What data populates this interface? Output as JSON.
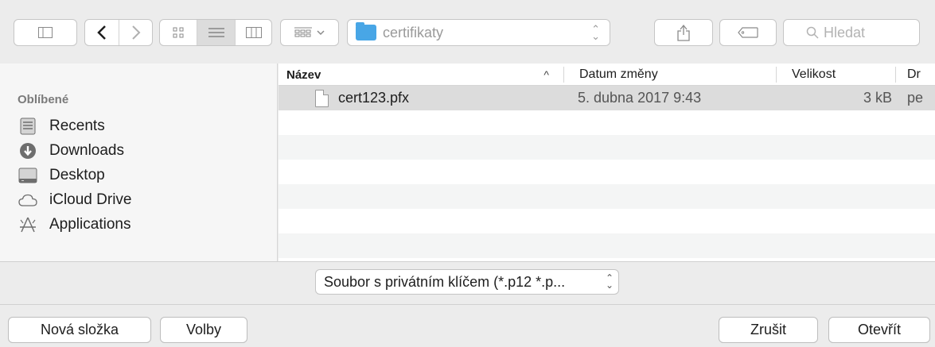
{
  "toolbar": {
    "path_label": "certifikaty",
    "search_placeholder": "Hledat"
  },
  "sidebar": {
    "heading": "Oblíbené",
    "items": [
      {
        "label": "Recents",
        "icon": "recents-icon"
      },
      {
        "label": "Downloads",
        "icon": "downloads-icon"
      },
      {
        "label": "Desktop",
        "icon": "desktop-icon"
      },
      {
        "label": "iCloud Drive",
        "icon": "icloud-icon"
      },
      {
        "label": "Applications",
        "icon": "applications-icon"
      }
    ]
  },
  "filelist": {
    "columns": {
      "name": "Název",
      "modified": "Datum změny",
      "size": "Velikost",
      "kind": "Dr"
    },
    "sort_indicator": "^",
    "rows": [
      {
        "name": "cert123.pfx",
        "modified": "5. dubna 2017 9:43",
        "size": "3 kB",
        "kind": "pe"
      }
    ]
  },
  "format_select": {
    "value": "Soubor s privátním klíčem (*.p12 *.p..."
  },
  "buttons": {
    "new_folder": "Nová složka",
    "options": "Volby",
    "cancel": "Zrušit",
    "open": "Otevřít"
  },
  "colors": {
    "folder": "#48a6e6",
    "selected_row": "#dcdcdc"
  }
}
